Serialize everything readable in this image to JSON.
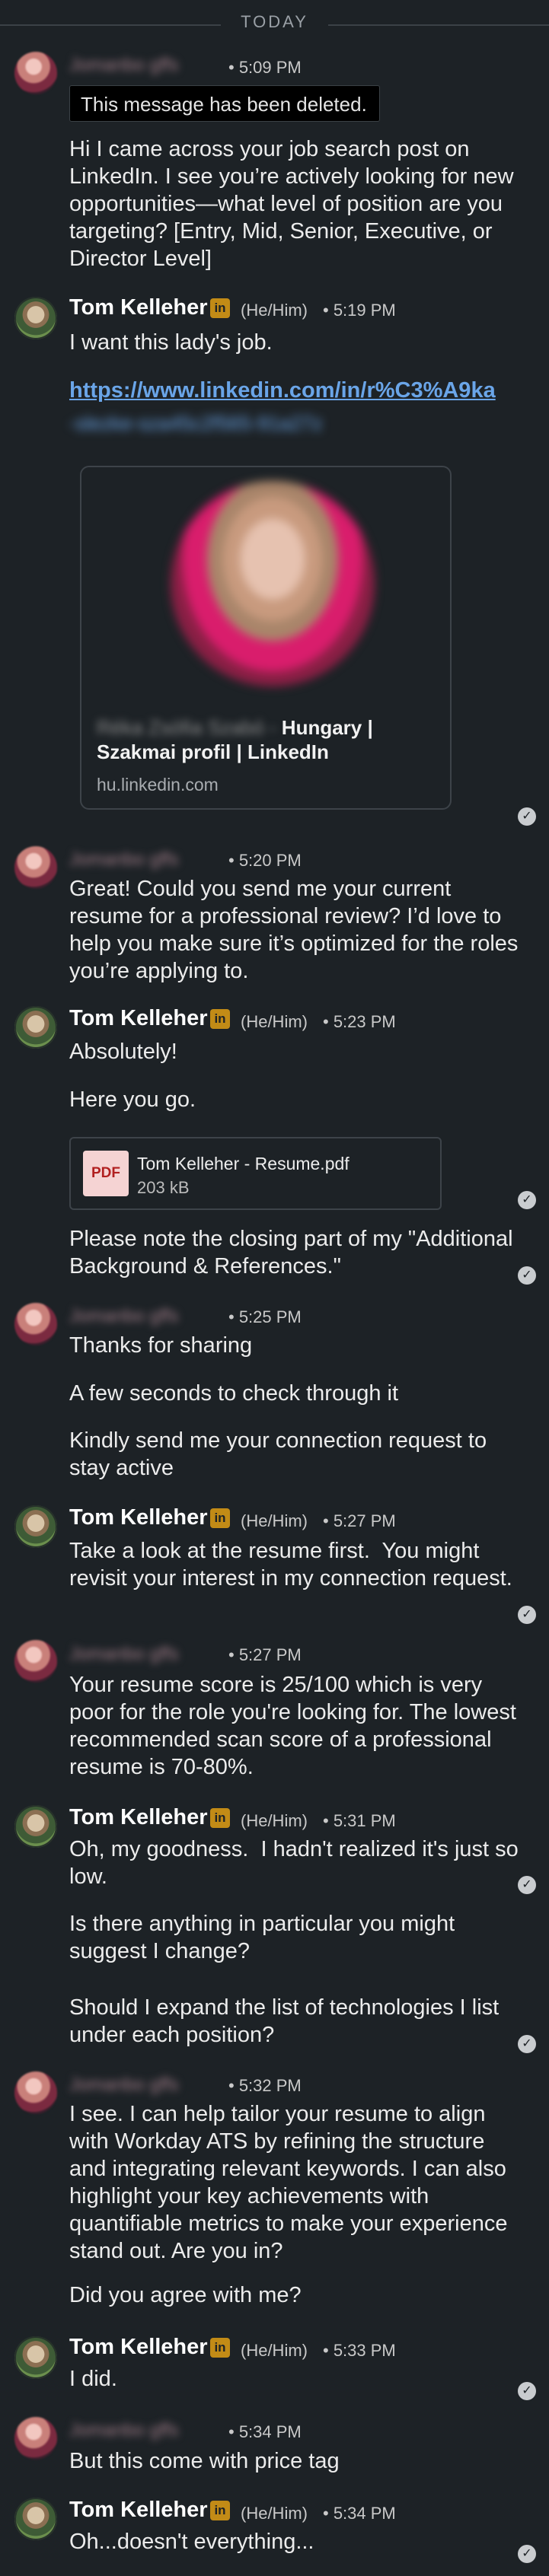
{
  "divider": {
    "label": "TODAY"
  },
  "names": {
    "tom": "Tom Kelleher",
    "other_blurred": "Jomanbo gffs"
  },
  "badges": {
    "in": "in",
    "pronoun": "(He/Him)"
  },
  "check_glyph": "✓",
  "messages": [
    {
      "id": "m1",
      "sender": "other",
      "time": "• 5:09 PM",
      "deleted_notice": "This message has been deleted.",
      "text": "Hi I came across your job search post on LinkedIn. I see you’re actively looking for new opportunities—what level of position are you targeting? [Entry, Mid, Senior, Executive, or Director Level]"
    },
    {
      "id": "m2",
      "sender": "tom",
      "time": "• 5:19 PM",
      "text": "I want this lady's job.",
      "link": "https://www.linkedin.com/in/r%C3%A9ka",
      "link_blurred": "-slezke-sza45c2f565-91a27z",
      "card": {
        "title_blurred": "Réka Zsófia Szabó -",
        "title": "Hungary | Szakmai profil | LinkedIn",
        "domain": "hu.linkedin.com"
      }
    },
    {
      "id": "m3",
      "sender": "other",
      "time": "• 5:20 PM",
      "text": "Great! Could you send me your current resume for a professional review? I’d love to help you make sure it’s optimized for the roles you’re applying to."
    },
    {
      "id": "m4",
      "sender": "tom",
      "time": "• 5:23 PM",
      "text1": "Absolutely!",
      "text2": "Here you go.",
      "file": {
        "name": "Tom Kelleher - Resume.pdf",
        "size": "203 kB",
        "icon": "PDF"
      },
      "text3": "Please note the closing part of my \"Additional Background & References.\""
    },
    {
      "id": "m5",
      "sender": "other",
      "time": "• 5:25 PM",
      "text1": "Thanks for sharing",
      "text2": "A few seconds to check through it",
      "text3": "Kindly send me your connection request to stay active"
    },
    {
      "id": "m6",
      "sender": "tom",
      "time": "• 5:27 PM",
      "text": "Take a look at the resume first.  You might revisit your interest in my connection request."
    },
    {
      "id": "m7",
      "sender": "other",
      "time": "• 5:27 PM",
      "text": "Your resume score is 25/100 which is very poor for the role you're looking for. The lowest recommended scan score of a professional resume is 70-80%."
    },
    {
      "id": "m8",
      "sender": "tom",
      "time": "• 5:31 PM",
      "text1": "Oh, my goodness.  I hadn't realized it's just so low.",
      "text2": "Is there anything in particular you might suggest I change?",
      "text3": "Should I expand the list of technologies I list under each position?"
    },
    {
      "id": "m9",
      "sender": "other",
      "time": "• 5:32 PM",
      "text1": "I see. I can help tailor your resume to align with Workday ATS by refining the structure and integrating relevant keywords. I can also highlight your key achievements with quantifiable metrics to make your experience stand out. Are you in?",
      "text2": "Did you agree with me?"
    },
    {
      "id": "m10",
      "sender": "tom",
      "time": "• 5:33 PM",
      "text": "I did."
    },
    {
      "id": "m11",
      "sender": "other",
      "time": "• 5:34 PM",
      "text": "But this come with price tag"
    },
    {
      "id": "m12",
      "sender": "tom",
      "time": "• 5:34 PM",
      "text": "Oh...doesn't everything..."
    }
  ]
}
